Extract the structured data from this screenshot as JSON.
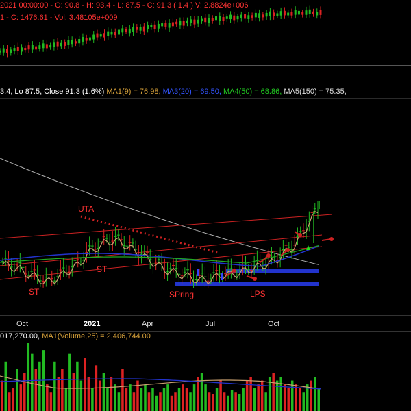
{
  "top_header": {
    "line1": "2021 00:00:00 - O: 90.8 - H: 93.4 - L: 87.5 - C: 91.3 ( 1.4 ) V: 2.8824e+006",
    "line2": "1 - C: 1476.61 - Vol: 3.48105e+009"
  },
  "main_header": {
    "ohlc": "3.4, Lo 87.5, Close 91.3 (1.6%)",
    "ma1": "MA1(9) = 76.98,",
    "ma3": "MA3(20) = 69.50,",
    "ma4": "MA4(50) = 68.86,",
    "ma5": "MA5(150) = 75.35,"
  },
  "vol_header": {
    "vol": "017,270.00,",
    "ma1": "MA1(Volume,25) = 2,406,744.00"
  },
  "x_axis": [
    "Oct",
    "2021",
    "Apr",
    "Jul",
    "Oct"
  ],
  "annotations": {
    "uta": "UTA",
    "st1": "ST",
    "st2": "ST",
    "spring": "SPring",
    "lps": "LPS"
  },
  "colors": {
    "up": "#22bb22",
    "down": "#dd2222",
    "ma_fast": "#c8a070",
    "ma_slow": "#b0b0b0",
    "ma_blue": "#2233cc",
    "ma_green": "#22aa22",
    "channel": "#cc2222",
    "support_bar": "#2233cc"
  },
  "chart_data": [
    {
      "type": "line",
      "panel": "index-overview",
      "series": [
        {
          "values": [
            0.2,
            0.22,
            0.25,
            0.28,
            0.3,
            0.33,
            0.36,
            0.4,
            0.45,
            0.52,
            0.55,
            0.6,
            0.63,
            0.66,
            0.7,
            0.72,
            0.75,
            0.78,
            0.8,
            0.83,
            0.85,
            0.87,
            0.88,
            0.9,
            0.92,
            0.94,
            0.95,
            0.96,
            0.97,
            0.96
          ]
        }
      ]
    },
    {
      "type": "line",
      "panel": "price",
      "series": [
        {
          "values": [
            62,
            61,
            60,
            58,
            57,
            55,
            56,
            58,
            60,
            62,
            66,
            68,
            70,
            71,
            70,
            68,
            66,
            64,
            62,
            60,
            59,
            58,
            57,
            56,
            56,
            57,
            58,
            58,
            59,
            60,
            61,
            62,
            63,
            66,
            68,
            72,
            78,
            82
          ]
        }
      ]
    },
    {
      "type": "bar",
      "panel": "volume",
      "values": [
        1.6,
        2.6,
        1.0,
        1.2,
        2.2,
        1.4,
        2.0,
        3.6,
        3.0,
        2.2,
        2.6,
        3.2,
        1.4,
        1.0,
        2.6,
        1.8,
        2.2,
        1.2,
        3.0,
        2.0,
        2.6,
        1.6,
        2.8,
        1.8,
        1.2,
        2.4,
        1.6,
        2.0,
        1.2,
        1.8,
        1.4,
        1.0,
        2.2,
        1.2,
        1.4,
        1.0,
        1.6,
        1.2,
        1.4,
        1.0,
        1.2,
        0.8,
        1.0,
        1.2,
        1.4,
        0.8,
        1.0,
        1.2,
        1.4,
        1.2,
        1.0,
        1.4,
        1.8,
        2.0,
        1.4,
        1.0,
        0.9,
        1.2,
        1.6,
        1.0,
        0.8,
        1.1,
        1.0,
        0.9,
        1.2,
        1.6,
        1.8,
        1.2,
        1.4,
        1.6,
        1.0,
        1.8,
        2.0,
        1.6,
        1.8,
        1.4,
        1.2,
        1.6,
        1.4,
        1.2,
        1.0,
        1.4,
        1.6,
        1.8,
        1.2
      ]
    }
  ]
}
